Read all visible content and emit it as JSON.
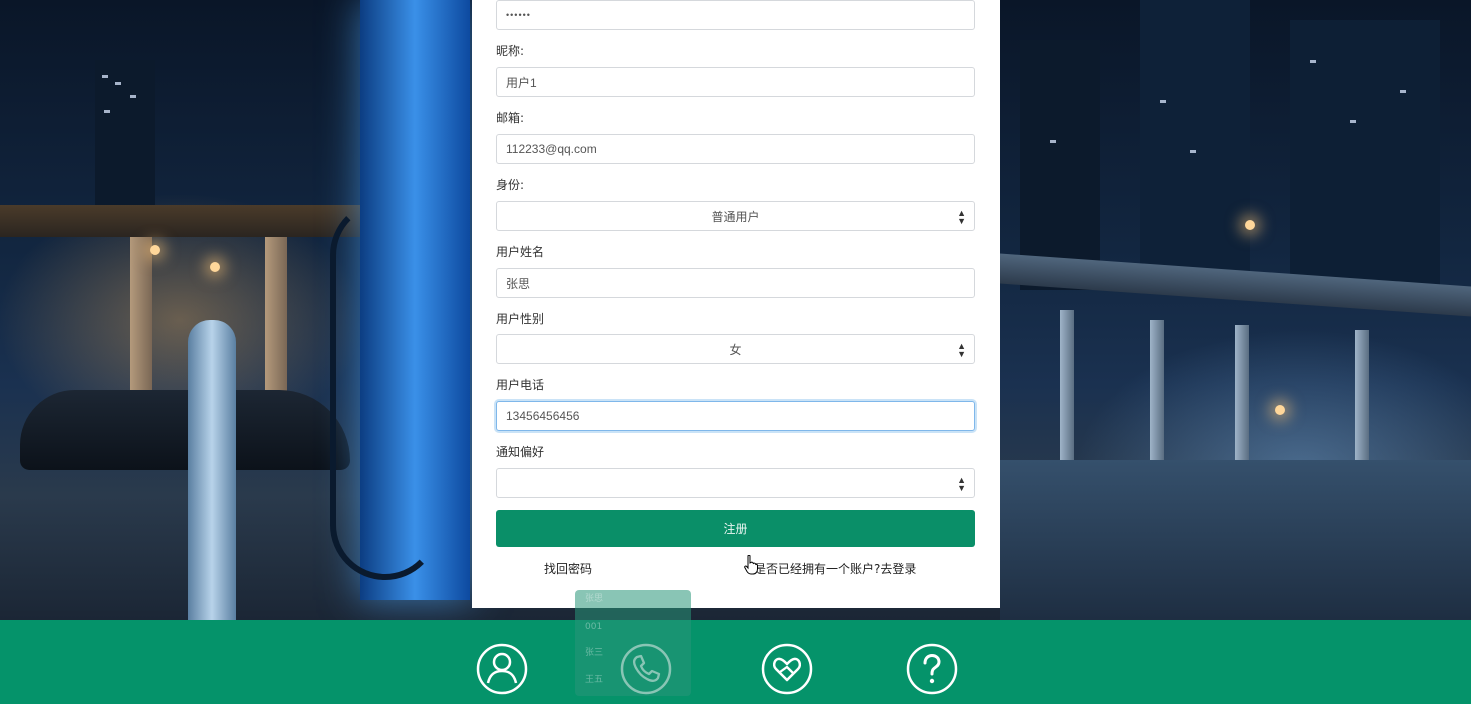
{
  "form": {
    "password_value": "••••••",
    "nickname": {
      "label": "昵称:",
      "value": "用户1"
    },
    "email": {
      "label": "邮箱:",
      "value": "112233@qq.com"
    },
    "role": {
      "label": "身份:",
      "selected": "普通用户"
    },
    "real_name": {
      "label": "用户姓名",
      "value": "张思"
    },
    "gender": {
      "label": "用户性别",
      "selected": "女"
    },
    "phone": {
      "label": "用户电话",
      "value": "13456456456"
    },
    "notify": {
      "label": "通知偏好",
      "selected": ""
    },
    "submit_label": "注册",
    "forgot_link": "找回密码",
    "login_link": "是否已经拥有一个账户?去登录"
  },
  "autocomplete": {
    "items": [
      "张思",
      "001",
      "张三",
      "王五"
    ]
  },
  "footer": {
    "items": [
      {
        "icon": "user-icon",
        "label": ""
      },
      {
        "icon": "phone-icon",
        "label": ""
      },
      {
        "icon": "heart-hand-icon",
        "label": ""
      },
      {
        "icon": "question-icon",
        "label": ""
      }
    ]
  },
  "colors": {
    "accent": "#05936a",
    "button": "#0a8f68",
    "focus_border": "#7fb7ea"
  }
}
